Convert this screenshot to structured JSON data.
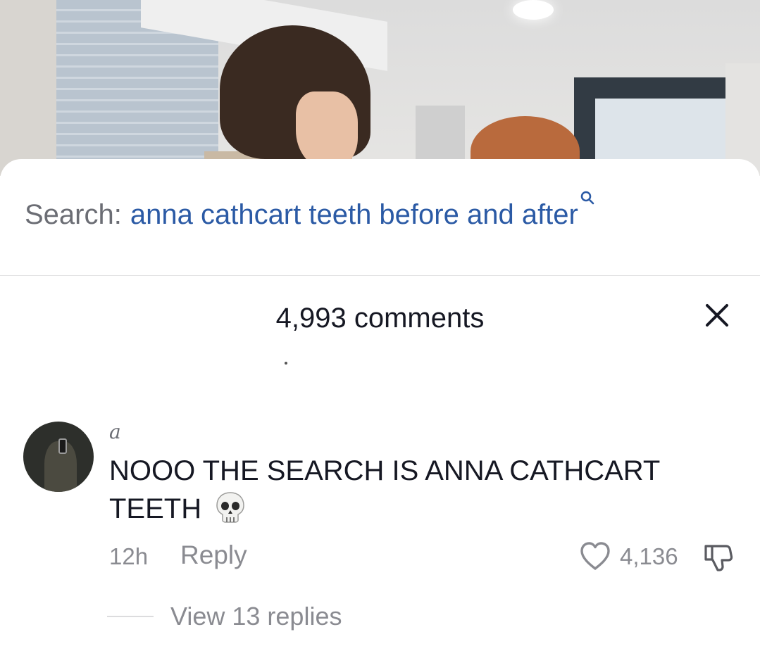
{
  "search": {
    "prefix": "Search:",
    "query": "anna cathcart teeth before and after",
    "icon": "search-icon",
    "query_color": "#2b5aa5"
  },
  "comments_header": {
    "title": "4,993 comments",
    "close_icon": "close-icon"
  },
  "comments": [
    {
      "username": "a",
      "text": "NOOO THE SEARCH IS ANNA CATHCART TEETH",
      "emoji": "skull-emoji",
      "time": "12h",
      "reply_label": "Reply",
      "likes": "4,136",
      "view_replies_label": "View 13 replies"
    }
  ],
  "colors": {
    "text_primary": "#161823",
    "text_secondary": "#8a8b91",
    "link_blue": "#2b5aa5"
  }
}
